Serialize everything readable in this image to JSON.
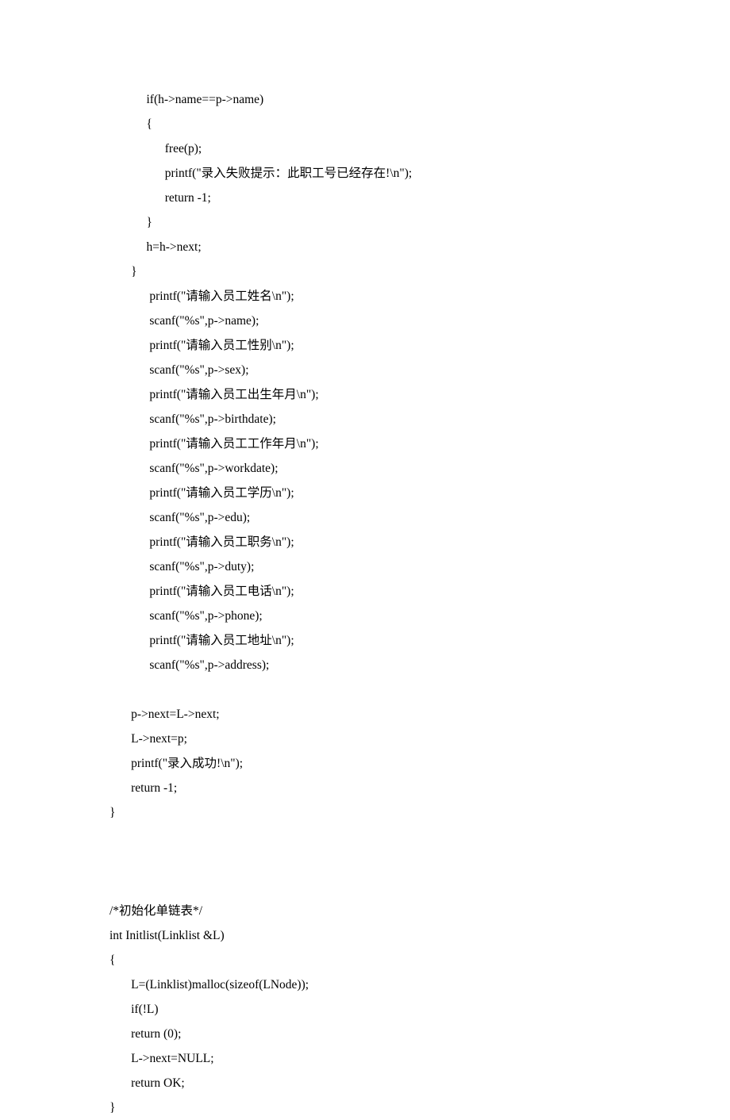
{
  "code": {
    "lines": [
      "            if(h->name==p->name)",
      "            {",
      "                  free(p);",
      "                  printf(\"录入失败提示：此职工号已经存在!\\n\");",
      "                  return -1;",
      "            }",
      "            h=h->next;",
      "       }",
      "             printf(\"请输入员工姓名\\n\");",
      "             scanf(\"%s\",p->name);",
      "             printf(\"请输入员工性别\\n\");",
      "             scanf(\"%s\",p->sex);",
      "             printf(\"请输入员工出生年月\\n\");",
      "             scanf(\"%s\",p->birthdate);",
      "             printf(\"请输入员工工作年月\\n\");",
      "             scanf(\"%s\",p->workdate);",
      "             printf(\"请输入员工学历\\n\");",
      "             scanf(\"%s\",p->edu);",
      "             printf(\"请输入员工职务\\n\");",
      "             scanf(\"%s\",p->duty);",
      "             printf(\"请输入员工电话\\n\");",
      "             scanf(\"%s\",p->phone);",
      "             printf(\"请输入员工地址\\n\");",
      "             scanf(\"%s\",p->address);",
      "",
      "       p->next=L->next;",
      "       L->next=p;",
      "       printf(\"录入成功!\\n\");",
      "       return -1;",
      "}",
      "",
      "",
      "",
      "/*初始化单链表*/",
      "int Initlist(Linklist &L)",
      "{",
      "       L=(Linklist)malloc(sizeof(LNode));",
      "       if(!L)",
      "       return (0);",
      "       L->next=NULL;",
      "       return OK;",
      "}"
    ]
  }
}
